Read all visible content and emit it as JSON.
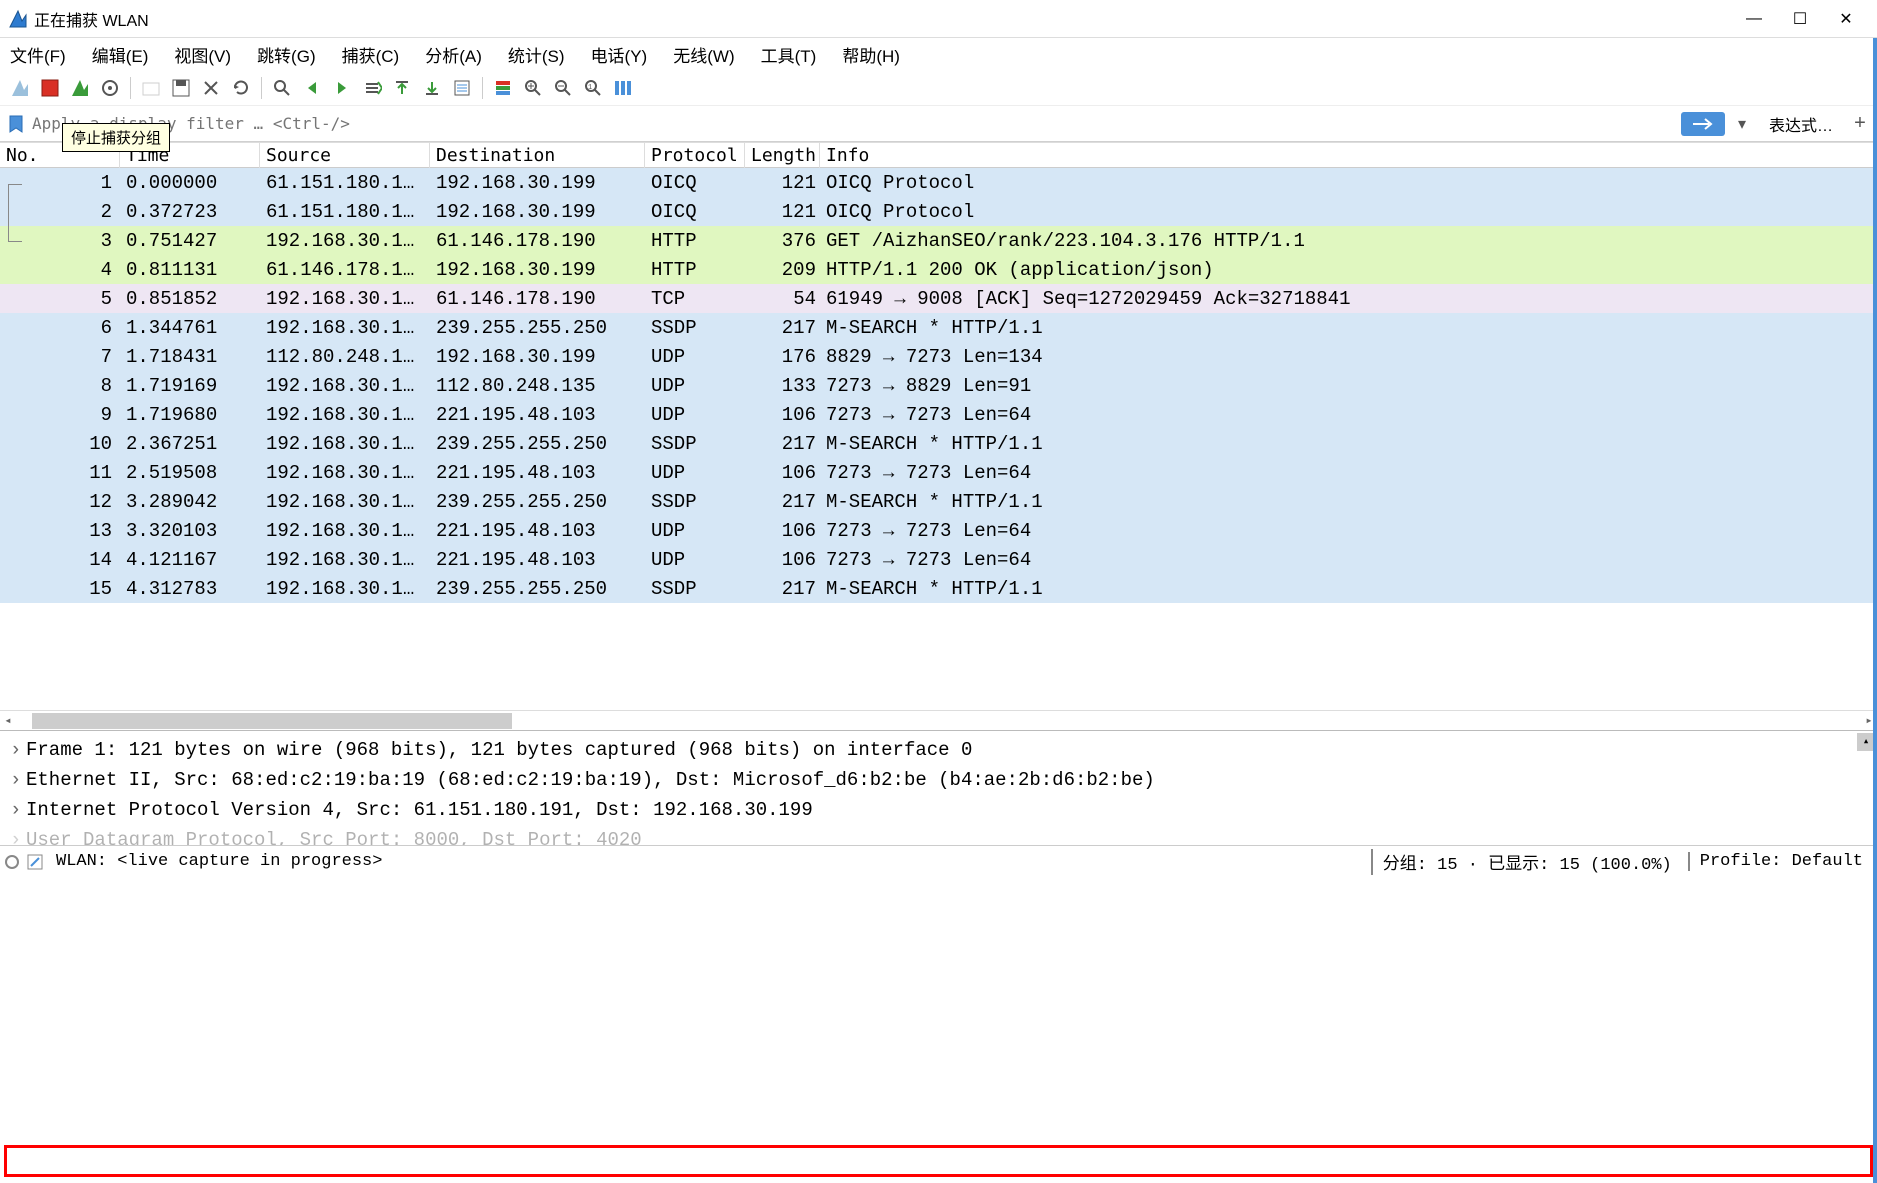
{
  "window": {
    "title": "正在捕获 WLAN"
  },
  "menu": {
    "file": "文件(F)",
    "edit": "编辑(E)",
    "view": "视图(V)",
    "go": "跳转(G)",
    "capture": "捕获(C)",
    "analyze": "分析(A)",
    "stats": "统计(S)",
    "telephony": "电话(Y)",
    "wireless": "无线(W)",
    "tools": "工具(T)",
    "help": "帮助(H)"
  },
  "tooltip": {
    "stop": "停止捕获分组"
  },
  "filter": {
    "placeholder": "Apply a display filter … <Ctrl-/>",
    "expression": "表达式…"
  },
  "columns": {
    "no": "No.",
    "time": "Time",
    "source": "Source",
    "dest": "Destination",
    "proto": "Protocol",
    "len": "Length",
    "info": "Info"
  },
  "packets": [
    {
      "no": "1",
      "time": "0.000000",
      "src": "61.151.180.1…",
      "dst": "192.168.30.199",
      "proto": "OICQ",
      "len": "121",
      "info": "OICQ Protocol",
      "bg": "bg-blue"
    },
    {
      "no": "2",
      "time": "0.372723",
      "src": "61.151.180.1…",
      "dst": "192.168.30.199",
      "proto": "OICQ",
      "len": "121",
      "info": "OICQ Protocol",
      "bg": "bg-blue"
    },
    {
      "no": "3",
      "time": "0.751427",
      "src": "192.168.30.1…",
      "dst": "61.146.178.190",
      "proto": "HTTP",
      "len": "376",
      "info": "GET /AizhanSEO/rank/223.104.3.176 HTTP/1.1",
      "bg": "bg-green"
    },
    {
      "no": "4",
      "time": "0.811131",
      "src": "61.146.178.1…",
      "dst": "192.168.30.199",
      "proto": "HTTP",
      "len": "209",
      "info": "HTTP/1.1 200 OK  (application/json)",
      "bg": "bg-green"
    },
    {
      "no": "5",
      "time": "0.851852",
      "src": "192.168.30.1…",
      "dst": "61.146.178.190",
      "proto": "TCP",
      "len": "54",
      "info": "61949 → 9008 [ACK] Seq=1272029459 Ack=32718841",
      "bg": "bg-lav"
    },
    {
      "no": "6",
      "time": "1.344761",
      "src": "192.168.30.1…",
      "dst": "239.255.255.250",
      "proto": "SSDP",
      "len": "217",
      "info": "M-SEARCH * HTTP/1.1",
      "bg": "bg-blue"
    },
    {
      "no": "7",
      "time": "1.718431",
      "src": "112.80.248.1…",
      "dst": "192.168.30.199",
      "proto": "UDP",
      "len": "176",
      "info": "8829 → 7273 Len=134",
      "bg": "bg-blue"
    },
    {
      "no": "8",
      "time": "1.719169",
      "src": "192.168.30.1…",
      "dst": "112.80.248.135",
      "proto": "UDP",
      "len": "133",
      "info": "7273 → 8829 Len=91",
      "bg": "bg-blue"
    },
    {
      "no": "9",
      "time": "1.719680",
      "src": "192.168.30.1…",
      "dst": "221.195.48.103",
      "proto": "UDP",
      "len": "106",
      "info": "7273 → 7273 Len=64",
      "bg": "bg-blue"
    },
    {
      "no": "10",
      "time": "2.367251",
      "src": "192.168.30.1…",
      "dst": "239.255.255.250",
      "proto": "SSDP",
      "len": "217",
      "info": "M-SEARCH * HTTP/1.1",
      "bg": "bg-blue"
    },
    {
      "no": "11",
      "time": "2.519508",
      "src": "192.168.30.1…",
      "dst": "221.195.48.103",
      "proto": "UDP",
      "len": "106",
      "info": "7273 → 7273 Len=64",
      "bg": "bg-blue"
    },
    {
      "no": "12",
      "time": "3.289042",
      "src": "192.168.30.1…",
      "dst": "239.255.255.250",
      "proto": "SSDP",
      "len": "217",
      "info": "M-SEARCH * HTTP/1.1",
      "bg": "bg-blue"
    },
    {
      "no": "13",
      "time": "3.320103",
      "src": "192.168.30.1…",
      "dst": "221.195.48.103",
      "proto": "UDP",
      "len": "106",
      "info": "7273 → 7273 Len=64",
      "bg": "bg-blue"
    },
    {
      "no": "14",
      "time": "4.121167",
      "src": "192.168.30.1…",
      "dst": "221.195.48.103",
      "proto": "UDP",
      "len": "106",
      "info": "7273 → 7273 Len=64",
      "bg": "bg-blue"
    },
    {
      "no": "15",
      "time": "4.312783",
      "src": "192.168.30.1…",
      "dst": "239.255.255.250",
      "proto": "SSDP",
      "len": "217",
      "info": "M-SEARCH * HTTP/1.1",
      "bg": "bg-blue"
    }
  ],
  "details": {
    "l1": "Frame 1: 121 bytes on wire (968 bits), 121 bytes captured (968 bits) on interface 0",
    "l2": "Ethernet II, Src: 68:ed:c2:19:ba:19 (68:ed:c2:19:ba:19), Dst: Microsof_d6:b2:be (b4:ae:2b:d6:b2:be)",
    "l3": "Internet Protocol Version 4, Src: 61.151.180.191, Dst: 192.168.30.199",
    "l4": "User Datagram Protocol, Src Port: 8000, Dst Port: 4020"
  },
  "status": {
    "iface": "WLAN: <live capture in progress>",
    "groups": "分组: 15  ·  已显示: 15 (100.0%)",
    "profile": "Profile: Default"
  }
}
